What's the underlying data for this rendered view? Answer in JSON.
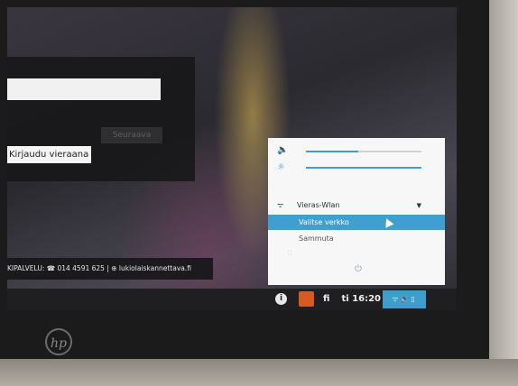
{
  "login": {
    "next_label": "Seuraava",
    "guest_label": "Kirjaudu vieraana"
  },
  "help_bar": {
    "text": "KIPALVELU: ☎ 014 4591 625  |  ⊕ lukiolaiskannettava.fi"
  },
  "taskbar": {
    "language": "fi",
    "clock": "ti 16:20"
  },
  "status_panel": {
    "volume_percent": 45,
    "brightness_percent": 100,
    "network_name": "Vieras-Wlan",
    "menu_items": [
      "Valitse verkko",
      "Sammuta"
    ]
  },
  "device": {
    "logo_text": "hp"
  },
  "colors": {
    "accent": "#3e9fd0",
    "taskbar": "#1f1f22",
    "panel": "#f7f7f7"
  },
  "icons": {
    "volume": "volume-icon",
    "brightness": "brightness-icon",
    "wifi": "wifi-icon",
    "power": "power-icon",
    "info": "info-icon"
  }
}
